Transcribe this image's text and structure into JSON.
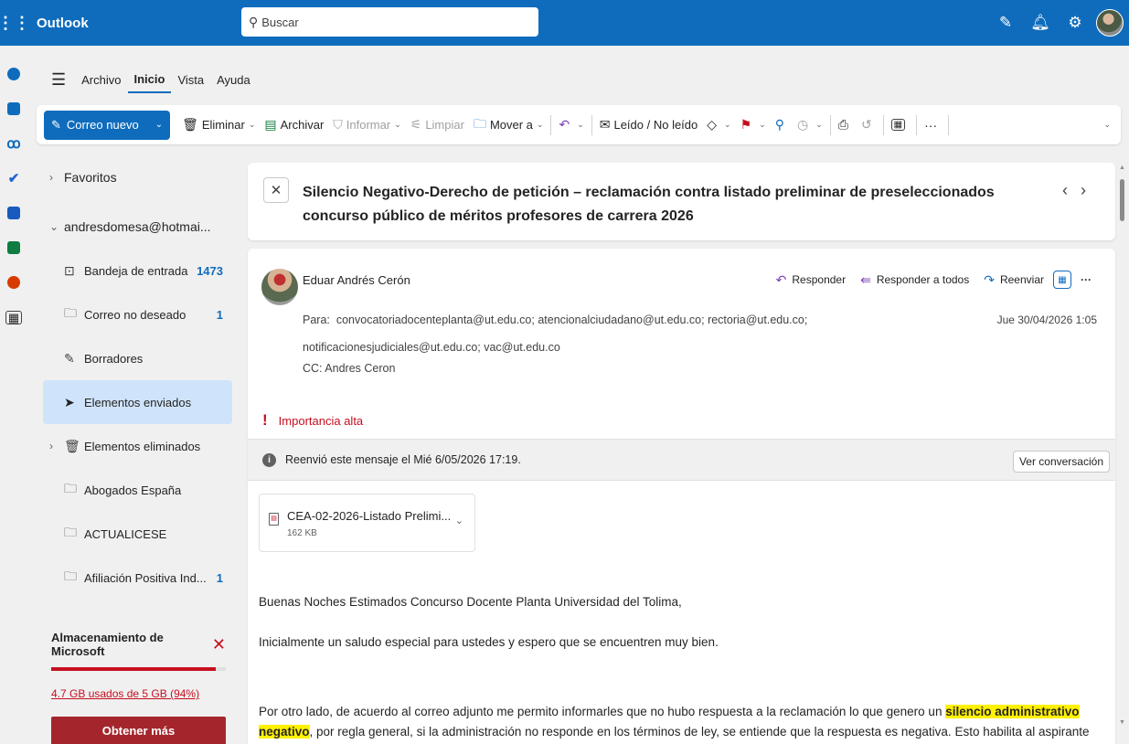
{
  "app": {
    "name": "Outlook"
  },
  "search": {
    "placeholder": "Buscar"
  },
  "menu": {
    "items": [
      "Archivo",
      "Inicio",
      "Vista",
      "Ayuda"
    ]
  },
  "ribbon": {
    "new_mail": "Correo nuevo",
    "delete": "Eliminar",
    "archive": "Archivar",
    "report": "Informar",
    "sweep": "Limpiar",
    "move": "Mover a",
    "read_unread": "Leído / No leído"
  },
  "folders": {
    "favorites": "Favoritos",
    "account": "andresdomesa@hotmai...",
    "items": [
      {
        "label": "Bandeja de entrada",
        "count": "1473"
      },
      {
        "label": "Correo no deseado",
        "count": "1"
      },
      {
        "label": "Borradores",
        "count": ""
      },
      {
        "label": "Elementos enviados",
        "count": ""
      },
      {
        "label": "Elementos eliminados",
        "count": ""
      },
      {
        "label": "Abogados España",
        "count": ""
      },
      {
        "label": "ACTUALICESE",
        "count": ""
      },
      {
        "label": "Afiliación Positiva Ind...",
        "count": "1"
      }
    ]
  },
  "storage": {
    "title": "Almacenamiento de Microsoft",
    "used": "4.7 GB usados de 5 GB (94%)",
    "used_fraction": 0.94,
    "button": "Obtener más"
  },
  "message": {
    "subject": "Silencio Negativo-Derecho de petición – reclamación contra listado preliminar de preseleccionados concurso público de méritos profesores de carrera 2026",
    "sender": "Eduar Andrés Cerón",
    "reply": "Responder",
    "reply_all": "Responder a todos",
    "forward": "Reenviar",
    "to_label": "Para:",
    "to_line1": "convocatoriadocenteplanta@ut.edu.co;  atencionalciudadano@ut.edu.co;  rectoria@ut.edu.co;",
    "to_line2": "notificacionesjudiciales@ut.edu.co;  vac@ut.edu.co",
    "date": "Jue 30/04/2026 1:05",
    "cc": "CC:  Andres Ceron",
    "importance": "Importancia alta",
    "forwarded_info": "Reenvió este mensaje el Mié 6/05/2026 17:19.",
    "view_conversation": "Ver conversación",
    "attachment": {
      "name": "CEA-02-2026-Listado Prelimi...",
      "size": "162 KB"
    },
    "body": {
      "greeting": "Buenas Noches Estimados Concurso Docente Planta Universidad del Tolima,",
      "p1": "Inicialmente un saludo especial para ustedes y espero que se encuentren muy bien.",
      "p2_start": "Por otro lado, de acuerdo al correo adjunto me permito informarles que no hubo respuesta a la reclamación lo que genero un ",
      "p2_highlight1": "silencio administrativo",
      "p2_highlight2": "negativo",
      "p2_end": ", por regla general, si la administración no responde en los términos de ley, se entiende que la respuesta es negativa. Esto habilita al aspirante para"
    }
  },
  "colors": {
    "brand": "#0f6cbd",
    "danger": "#c50f1f",
    "selected": "#cfe4fa",
    "highlight": "#fff100"
  }
}
